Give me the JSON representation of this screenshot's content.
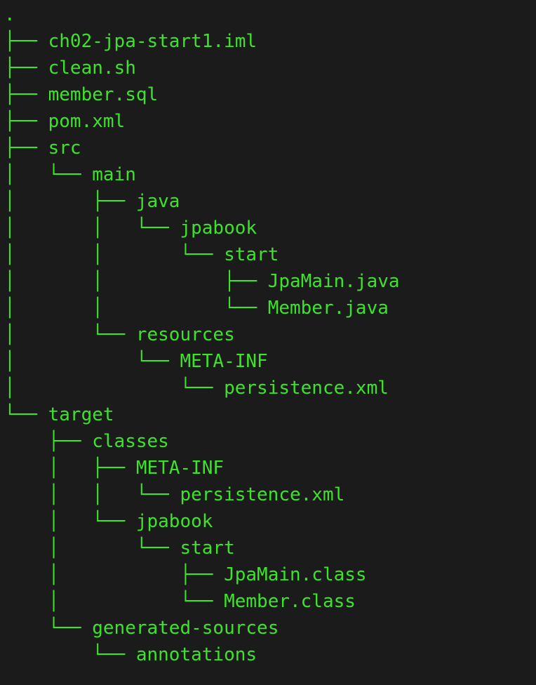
{
  "terminal": {
    "fg_color": "#3de32b",
    "bg_color": "#1b1b1b"
  },
  "tree": {
    "lines": [
      {
        "prefix": "",
        "name": "."
      },
      {
        "prefix": "├── ",
        "name": "ch02-jpa-start1.iml"
      },
      {
        "prefix": "├── ",
        "name": "clean.sh"
      },
      {
        "prefix": "├── ",
        "name": "member.sql"
      },
      {
        "prefix": "├── ",
        "name": "pom.xml"
      },
      {
        "prefix": "├── ",
        "name": "src"
      },
      {
        "prefix": "│   └── ",
        "name": "main"
      },
      {
        "prefix": "│       ├── ",
        "name": "java"
      },
      {
        "prefix": "│       │   └── ",
        "name": "jpabook"
      },
      {
        "prefix": "│       │       └── ",
        "name": "start"
      },
      {
        "prefix": "│       │           ├── ",
        "name": "JpaMain.java"
      },
      {
        "prefix": "│       │           └── ",
        "name": "Member.java"
      },
      {
        "prefix": "│       └── ",
        "name": "resources"
      },
      {
        "prefix": "│           └── ",
        "name": "META-INF"
      },
      {
        "prefix": "│               └── ",
        "name": "persistence.xml"
      },
      {
        "prefix": "└── ",
        "name": "target"
      },
      {
        "prefix": "    ├── ",
        "name": "classes"
      },
      {
        "prefix": "    │   ├── ",
        "name": "META-INF"
      },
      {
        "prefix": "    │   │   └── ",
        "name": "persistence.xml"
      },
      {
        "prefix": "    │   └── ",
        "name": "jpabook"
      },
      {
        "prefix": "    │       └── ",
        "name": "start"
      },
      {
        "prefix": "    │           ├── ",
        "name": "JpaMain.class"
      },
      {
        "prefix": "    │           └── ",
        "name": "Member.class"
      },
      {
        "prefix": "    └── ",
        "name": "generated-sources"
      },
      {
        "prefix": "        └── ",
        "name": "annotations"
      }
    ]
  }
}
